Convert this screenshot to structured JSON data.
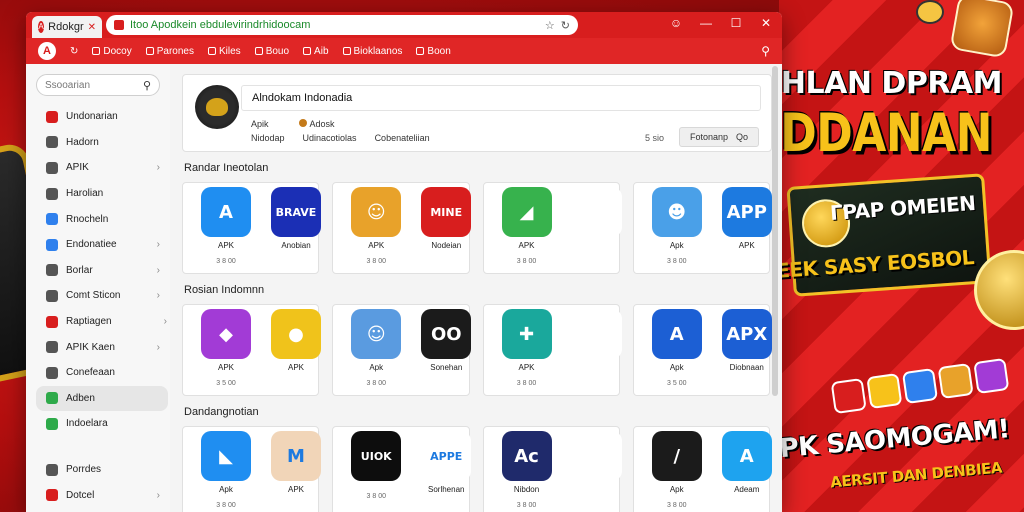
{
  "browser": {
    "tab_title": "Rdokgr",
    "address": "Itoo Apodkein ebdulevirindrhidoocam",
    "window_controls": [
      "☺",
      "—",
      "☐",
      "✕"
    ]
  },
  "toolbar": {
    "items": [
      "Docoy",
      "Parones",
      "Kiles",
      "Bouo",
      "Aib",
      "Bioklaanos",
      "Boon"
    ]
  },
  "sidebar": {
    "search_placeholder": "Ssooarian",
    "items": [
      {
        "label": "Undonarian",
        "color": "#d81e1e",
        "chevron": false
      },
      {
        "label": "Hadorn",
        "color": "#555555",
        "chevron": false
      },
      {
        "label": "APIK",
        "color": "#555555",
        "chevron": true
      },
      {
        "label": "Harolian",
        "color": "#555555",
        "chevron": false
      },
      {
        "label": "Rnocheln",
        "color": "#2f80ed",
        "chevron": false
      },
      {
        "label": "Endonatiee",
        "color": "#2f80ed",
        "chevron": true
      },
      {
        "label": "Borlar",
        "color": "#555555",
        "chevron": true
      },
      {
        "label": "Comt Sticon",
        "color": "#555555",
        "chevron": true
      },
      {
        "label": "Raptiagen",
        "color": "#d81e1e",
        "chevron": true,
        "dot": true
      },
      {
        "label": "APIK Kaen",
        "color": "#555555",
        "chevron": true
      },
      {
        "label": "Conefeaan",
        "color": "#555555",
        "chevron": false
      },
      {
        "label": "Adben",
        "color": "#2eaa4a",
        "chevron": false,
        "active": true
      },
      {
        "label": "Indoelara",
        "color": "#2eaa4a",
        "chevron": false
      }
    ],
    "bottom_items": [
      {
        "label": "Porrdes",
        "color": "#555555",
        "chevron": false
      },
      {
        "label": "Dotcel",
        "color": "#d81e1e",
        "chevron": true
      }
    ]
  },
  "profile": {
    "name": "Alndokam Indonadia",
    "row2_left": "Apik",
    "row2_right": "Adosk",
    "row3": [
      "Nidodap",
      "Udinacotiolas",
      "Cobenateliian"
    ],
    "count": "5 sio",
    "button_label": "Fotonanp",
    "button_extra": "Qo"
  },
  "sections": [
    {
      "title": "Randar Ineotolan",
      "cards": [
        [
          {
            "label": "APK",
            "sub": "",
            "icon": "A",
            "bg": "#1f8ef1"
          },
          {
            "label": "Anobian",
            "sub": "",
            "icon": "BRAVE",
            "bg": "#1b2fb5"
          }
        ],
        [
          {
            "label": "APK",
            "sub": "",
            "icon": "☺",
            "bg": "#e8a22a"
          },
          {
            "label": "Nodeian",
            "sub": "",
            "icon": "MINE",
            "bg": "#d81e1e"
          }
        ],
        [
          {
            "label": "APK",
            "sub": "",
            "icon": "◢",
            "bg": "#37b24d"
          },
          {
            "label": "",
            "sub": "",
            "icon": "",
            "bg": "#ffffff"
          }
        ],
        [
          {
            "label": "Apk",
            "sub": "",
            "icon": "☻",
            "bg": "#4aa0e8"
          },
          {
            "label": "APK",
            "sub": "",
            "icon": "APP",
            "bg": "#1d7ae0"
          }
        ]
      ],
      "subs": [
        "3 8 00",
        "3 8 00",
        "3 8 00",
        "3 8 00"
      ]
    },
    {
      "title": "Rosian Indomnn",
      "cards": [
        [
          {
            "label": "APK",
            "sub": "",
            "icon": "◆",
            "bg": "#a23bd6"
          },
          {
            "label": "APK",
            "sub": "",
            "icon": "●",
            "bg": "#f0c31b"
          }
        ],
        [
          {
            "label": "Apk",
            "sub": "",
            "icon": "☺",
            "bg": "#5a9be0"
          },
          {
            "label": "Sonehan",
            "sub": "",
            "icon": "OO",
            "bg": "#1b1b1b"
          }
        ],
        [
          {
            "label": "APK",
            "sub": "",
            "icon": "✚",
            "bg": "#1aa89c"
          },
          {
            "label": "",
            "sub": "",
            "icon": "",
            "bg": "#ffffff"
          }
        ],
        [
          {
            "label": "Apk",
            "sub": "",
            "icon": "A",
            "bg": "#1c5fd4"
          },
          {
            "label": "Diobnaan",
            "sub": "",
            "icon": "APX",
            "bg": "#1c5fd4"
          }
        ]
      ],
      "subs": [
        "3 5 00",
        "3 8 00",
        "3 8 00",
        "3 5 00"
      ]
    },
    {
      "title": "Dandangnotian",
      "cards": [
        [
          {
            "label": "Apk",
            "sub": "",
            "icon": "◣",
            "bg": "#1f8ef1"
          },
          {
            "label": "APK",
            "sub": "",
            "icon": "M",
            "bg": "#f1d5b8"
          }
        ],
        [
          {
            "label": "",
            "sub": "",
            "icon": "UIOK",
            "bg": "#0d0d0d"
          },
          {
            "label": "Sorlhenan",
            "sub": "",
            "icon": "APPE",
            "bg": "#ffffff"
          }
        ],
        [
          {
            "label": "Nibdon",
            "sub": "",
            "icon": "Ac",
            "bg": "#1f2a6b"
          },
          {
            "label": "",
            "sub": "",
            "icon": "",
            "bg": "#ffffff"
          }
        ],
        [
          {
            "label": "Apk",
            "sub": "",
            "icon": "/",
            "bg": "#1b1b1b"
          },
          {
            "label": "Adeam",
            "sub": "",
            "icon": "A",
            "bg": "#1ea3ef"
          }
        ]
      ],
      "subs": [
        "3 8 00",
        "3 8 00",
        "3 8 00",
        "3 8 00"
      ]
    }
  ],
  "promo": {
    "line1": "PIOHLAN DPRAM",
    "line2": "INDDANAN",
    "line3": "ΓPAP OMEIEN",
    "line4": "",
    "line5": "EEK SASY EOSBOL",
    "line6": "URF OPK SAOMOGAM!",
    "line7": "AERSIT DAN DENBIEA"
  },
  "colors": {
    "brand_red": "#d81e1e",
    "accent_gold": "#f7c21a"
  }
}
